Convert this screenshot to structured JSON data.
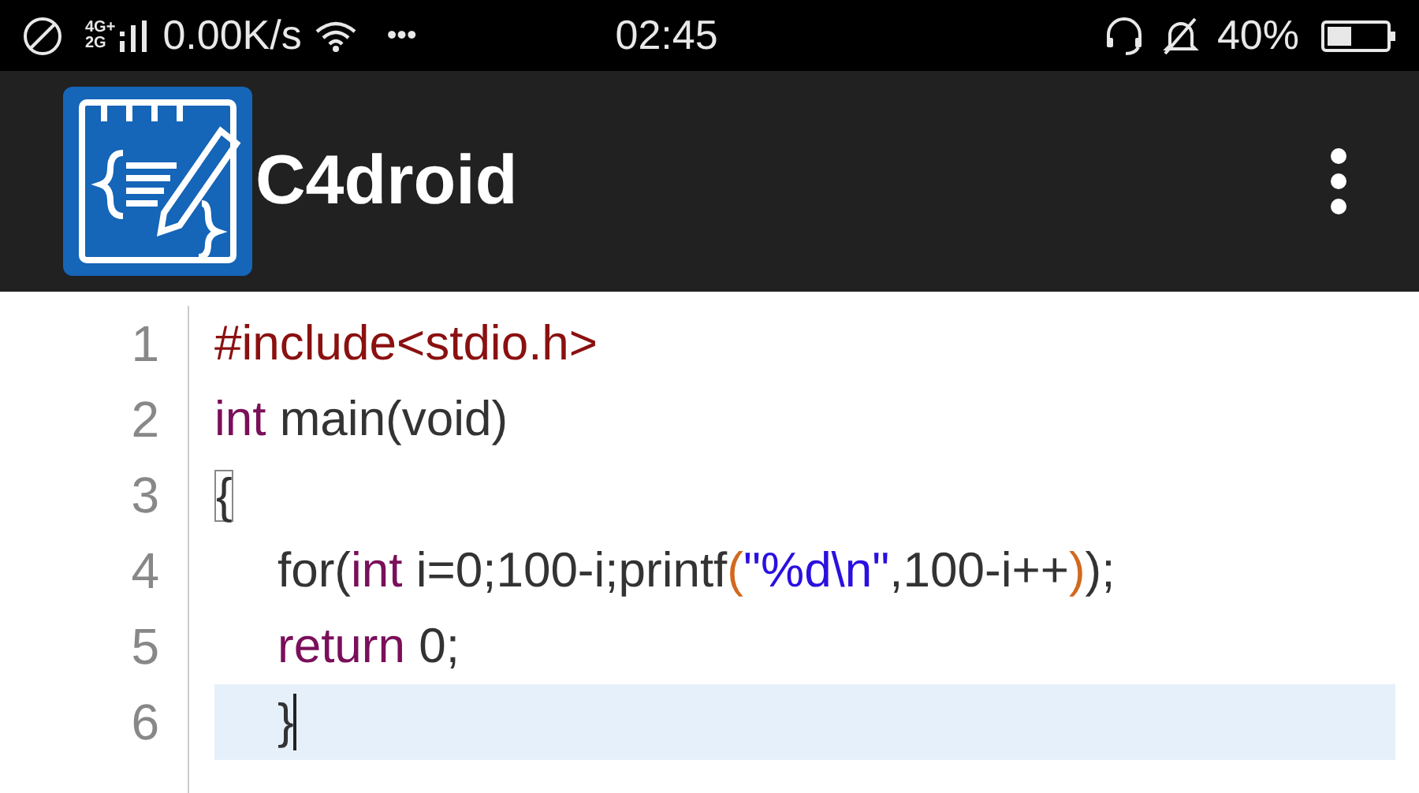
{
  "status_bar": {
    "network_top": "4G+",
    "network_bottom": "2G",
    "speed": "0.00K/s",
    "more": "•••",
    "time": "02:45",
    "battery": "40%"
  },
  "app_bar": {
    "title": "C4droid"
  },
  "editor": {
    "lines": [
      {
        "number": "1",
        "indented": false,
        "selected": false,
        "tokens": [
          {
            "kind": "preprocessor",
            "text": "#include<stdio.h>"
          }
        ]
      },
      {
        "number": "2",
        "indented": false,
        "selected": false,
        "tokens": [
          {
            "kind": "keyword",
            "text": "int"
          },
          {
            "kind": "plain",
            "text": " main(void)"
          }
        ]
      },
      {
        "number": "3",
        "indented": false,
        "selected": false,
        "tokens": [
          {
            "kind": "matched",
            "text": "{"
          }
        ]
      },
      {
        "number": "4",
        "indented": true,
        "selected": false,
        "tokens": [
          {
            "kind": "plain",
            "text": "for("
          },
          {
            "kind": "keyword",
            "text": "int"
          },
          {
            "kind": "plain",
            "text": " i=0;100-i;printf"
          },
          {
            "kind": "paren",
            "text": "("
          },
          {
            "kind": "string",
            "text": "\"%d\\n\""
          },
          {
            "kind": "plain",
            "text": ",100-i++"
          },
          {
            "kind": "paren",
            "text": ")"
          },
          {
            "kind": "plain",
            "text": ");"
          }
        ]
      },
      {
        "number": "5",
        "indented": true,
        "selected": false,
        "tokens": [
          {
            "kind": "keyword",
            "text": "return"
          },
          {
            "kind": "plain",
            "text": " 0;"
          }
        ]
      },
      {
        "number": "6",
        "indented": true,
        "selected": true,
        "tokens": [
          {
            "kind": "plain",
            "text": "}"
          }
        ]
      }
    ]
  }
}
